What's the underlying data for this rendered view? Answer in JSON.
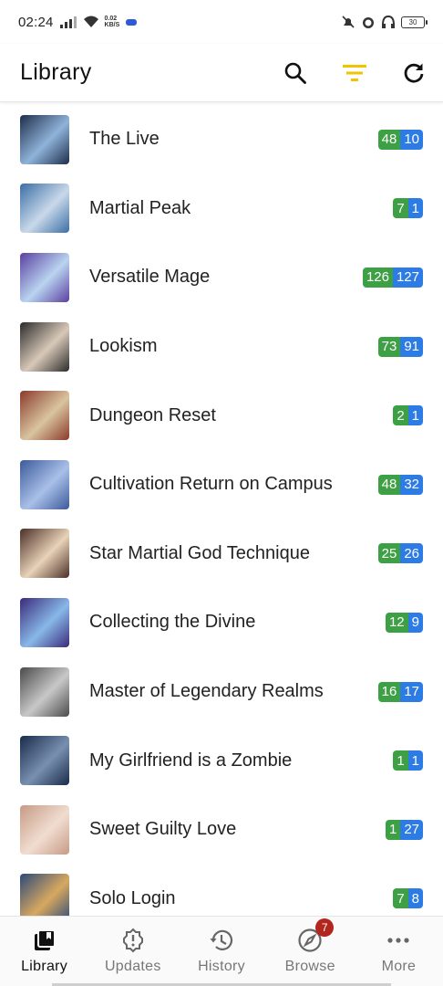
{
  "status_bar": {
    "time": "02:24",
    "net_speed_value": "0.02",
    "net_speed_unit": "KB/S",
    "battery": "30"
  },
  "appbar": {
    "title": "Library",
    "filter_color": "#f3c300"
  },
  "library": {
    "items": [
      {
        "title": "The Live",
        "unread": "48",
        "downloaded": "10",
        "cover": [
          "#1e2d4a",
          "#8fb3d9"
        ]
      },
      {
        "title": "Martial Peak",
        "unread": "7",
        "downloaded": "1",
        "cover": [
          "#3a6ea5",
          "#c9d9ea"
        ]
      },
      {
        "title": "Versatile Mage",
        "unread": "126",
        "downloaded": "127",
        "cover": [
          "#5a3fa0",
          "#b9d4f0"
        ]
      },
      {
        "title": "Lookism",
        "unread": "73",
        "downloaded": "91",
        "cover": [
          "#2b2b2b",
          "#d8c8b8"
        ]
      },
      {
        "title": "Dungeon Reset",
        "unread": "2",
        "downloaded": "1",
        "cover": [
          "#8a3a2a",
          "#d9c4a0"
        ]
      },
      {
        "title": "Cultivation Return on Campus",
        "unread": "48",
        "downloaded": "32",
        "cover": [
          "#3b5a9a",
          "#a9c0e8"
        ]
      },
      {
        "title": "Star Martial God Technique",
        "unread": "25",
        "downloaded": "26",
        "cover": [
          "#4a2f26",
          "#e8d2b8"
        ]
      },
      {
        "title": "Collecting the Divine",
        "unread": "12",
        "downloaded": "9",
        "cover": [
          "#3a2a7a",
          "#88b8e8"
        ]
      },
      {
        "title": "Master of Legendary Realms",
        "unread": "16",
        "downloaded": "17",
        "cover": [
          "#4a4a4a",
          "#c8c8c8"
        ]
      },
      {
        "title": "My Girlfriend is a Zombie",
        "unread": "1",
        "downloaded": "1",
        "cover": [
          "#1a2a4a",
          "#7890b0"
        ]
      },
      {
        "title": "Sweet Guilty Love",
        "unread": "1",
        "downloaded": "27",
        "cover": [
          "#c79a86",
          "#f0ddd0"
        ]
      },
      {
        "title": "Solo Login",
        "unread": "7",
        "downloaded": "8",
        "cover": [
          "#2a4a7a",
          "#d8a860"
        ]
      }
    ]
  },
  "bottom_nav": {
    "items": [
      {
        "label": "Library",
        "icon": "library-icon"
      },
      {
        "label": "Updates",
        "icon": "updates-icon"
      },
      {
        "label": "History",
        "icon": "history-icon"
      },
      {
        "label": "Browse",
        "icon": "browse-compass-icon",
        "badge": "7"
      },
      {
        "label": "More",
        "icon": "more-dots-icon"
      }
    ]
  },
  "colors": {
    "unread_badge": "#3ea044",
    "download_badge": "#2d7be5",
    "nav_badge": "#b3261e"
  }
}
